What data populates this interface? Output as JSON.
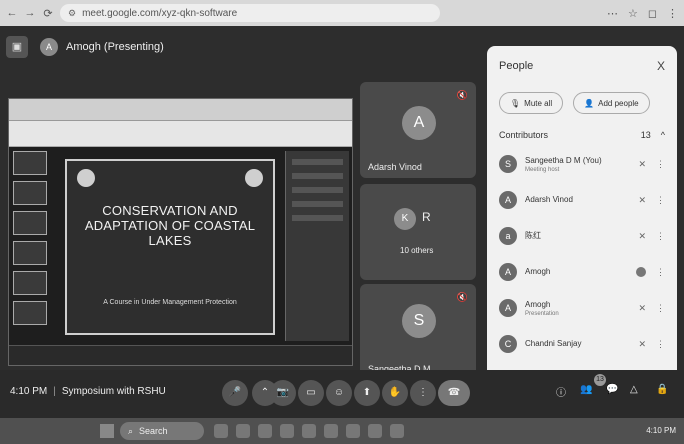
{
  "browser": {
    "url": "meet.google.com/xyz-qkn-software",
    "nav": [
      "←",
      "→",
      "⟳"
    ],
    "actions": [
      "⋯",
      "☆",
      "◻",
      "⋮"
    ]
  },
  "meet": {
    "presenting_label": "Amogh (Presenting)",
    "presenter_initial": "A"
  },
  "slide": {
    "title": "CONSERVATION AND ADAPTATION OF COASTAL LAKES",
    "subtitle": "A Course in Under Management Protection"
  },
  "tiles": [
    {
      "initial": "A",
      "name": "Adarsh Vinod",
      "mic": "🔇"
    },
    {
      "initial": "K",
      "extra_initial": "R",
      "name": "10 others",
      "mic": ""
    },
    {
      "initial": "S",
      "name": "Sangeetha D M",
      "mic": "🔇"
    }
  ],
  "people": {
    "title": "People",
    "close": "X",
    "mute_all": "Mute all",
    "add_people": "Add people",
    "contributors_label": "Contributors",
    "contributors_count": "13",
    "persons": [
      {
        "initial": "S",
        "name": "Sangeetha D M (You)",
        "sub": "Meeting host"
      },
      {
        "initial": "A",
        "name": "Adarsh Vinod",
        "sub": ""
      },
      {
        "initial": "a",
        "name": "陈红",
        "sub": ""
      },
      {
        "initial": "A",
        "name": "Amogh",
        "sub": ""
      },
      {
        "initial": "A",
        "name": "Amogh",
        "sub": "Presentation"
      },
      {
        "initial": "C",
        "name": "Chandni Sanjay",
        "sub": ""
      }
    ]
  },
  "controls": {
    "time": "4:10 PM",
    "separator": "|",
    "meeting_title": "Symposium with RSHU",
    "badge_count": "13",
    "buttons": [
      "🎤",
      "⌃",
      "📷",
      "▭",
      "☺",
      "⬆",
      "✋",
      "⋮",
      "☎"
    ],
    "right": [
      "ⓘ",
      "👥",
      "💬",
      "△",
      "🔒"
    ]
  },
  "taskbar": {
    "search_label": "Search",
    "clock": "4:10 PM"
  }
}
